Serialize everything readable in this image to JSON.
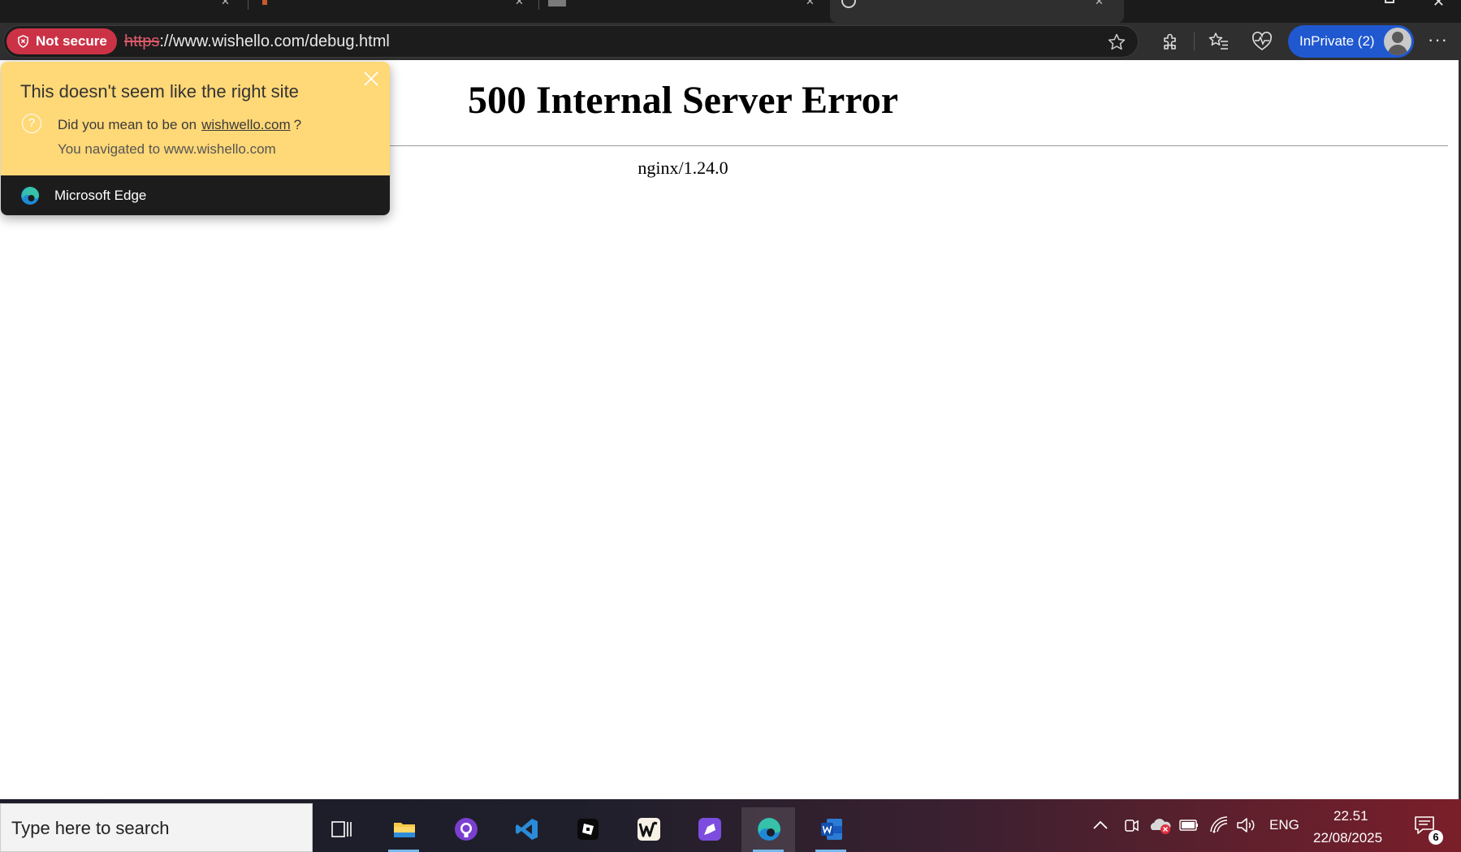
{
  "browser": {
    "security_chip": "Not secure",
    "url_scheme": "https",
    "url_rest": "://www.wishello.com/debug.html",
    "profile_label": "InPrivate (2)",
    "more_label": "···"
  },
  "page": {
    "heading": "500 Internal Server Error",
    "server": "nginx/1.24.0"
  },
  "flyout": {
    "title": "This doesn't seem like the right site",
    "question_prefix": "Did you mean to be on",
    "suggested_site": "wishwello.com",
    "question_suffix": "?",
    "navigated": "You navigated to www.wishello.com",
    "footer": "Microsoft Edge"
  },
  "taskbar": {
    "search_placeholder": "Type here to search",
    "apps": [
      "task-view",
      "file-explorer",
      "github-desktop",
      "vs-code",
      "roblox-studio",
      "wattpad",
      "clipchamp",
      "microsoft-edge",
      "microsoft-word"
    ],
    "language": "ENG",
    "time": "22.51",
    "date": "22/08/2025",
    "notifications": "6"
  },
  "colors": {
    "not_secure": "#cc3246",
    "inprivate": "#2058d0",
    "flyout_warning": "#ffd877",
    "flyout_footer": "#1c1c1c"
  }
}
